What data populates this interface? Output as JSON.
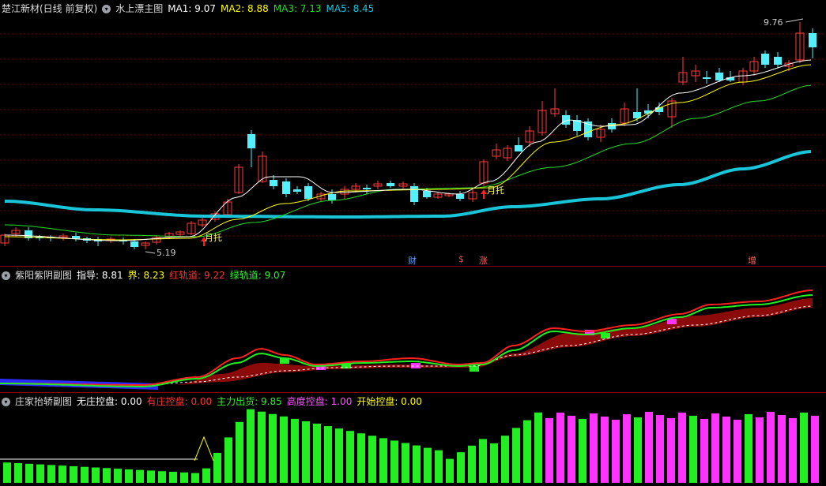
{
  "main": {
    "title": "楚江新材(日线 前复权)",
    "indicator": "水上漂主图",
    "ma1_label": "MA1: 9.07",
    "ma2_label": "MA2: 8.88",
    "ma3_label": "MA3: 7.13",
    "ma5_label": "MA5: 8.45",
    "high_label": "9.76",
    "low_label": "5.19",
    "tuo_label": "月托",
    "markers": [
      "财",
      "$",
      "涨",
      "增"
    ],
    "colors": {
      "up": "#ff3b3b",
      "down": "#54f0ff",
      "ma1": "#ffffff",
      "ma2": "#ffff00",
      "ma3": "#22dd22",
      "ma5": "#19c5d8"
    }
  },
  "sub1": {
    "name": "紫阳紫阴副图",
    "zhidao": "指导: 8.81",
    "jie": "界: 8.23",
    "hong": "红轨道: 9.22",
    "lv": "绿轨道: 9.07"
  },
  "sub2": {
    "name": "庄家抬轿副图",
    "wuzhuang": "无庄控盘: 0.00",
    "youzhuang": "有庄控盘: 0.00",
    "zhuli": "主力出货: 9.85",
    "gaodu": "高度控盘: 1.00",
    "kaishi": "开始控盘: 0.00"
  }
}
